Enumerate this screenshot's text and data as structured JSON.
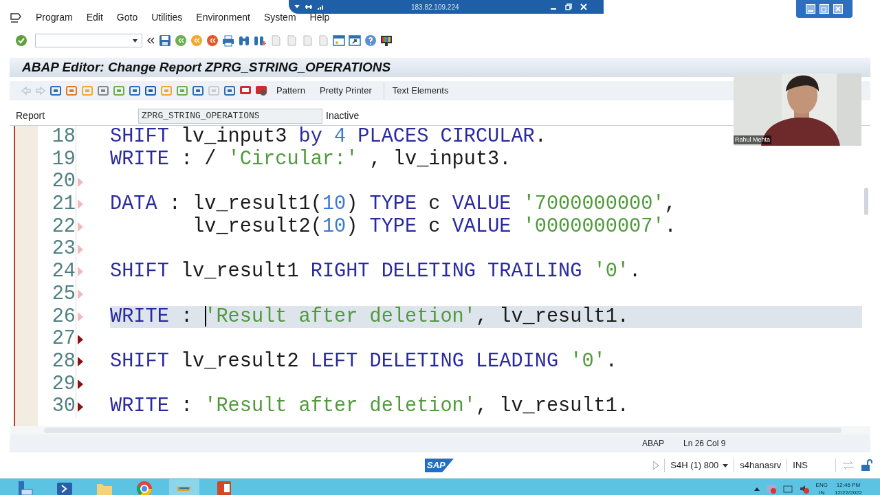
{
  "menu": [
    "Program",
    "Edit",
    "Goto",
    "Utilities",
    "Environment",
    "System",
    "Help"
  ],
  "connection": {
    "host": "183.82.109.224"
  },
  "title": "ABAP Editor: Change Report ZPRG_STRING_OPERATIONS",
  "app_toolbar": {
    "buttons": [
      "Pattern",
      "Pretty Printer",
      "Text Elements"
    ]
  },
  "report": {
    "label": "Report",
    "value": "ZPRG_STRING_OPERATIONS",
    "status": "Inactive"
  },
  "editor": {
    "lines": [
      {
        "number": "18",
        "selected": false,
        "tokens": [
          {
            "kind": "kw",
            "text": "SHIFT"
          },
          {
            "kind": "txt",
            "text": " lv_input3 "
          },
          {
            "kind": "kw",
            "text": "by "
          },
          {
            "kind": "num",
            "text": "4 "
          },
          {
            "kind": "kw",
            "text": "PLACES CIRCULAR"
          },
          {
            "kind": "txt",
            "text": "."
          }
        ]
      },
      {
        "number": "19",
        "selected": false,
        "tokens": [
          {
            "kind": "kw",
            "text": "WRITE"
          },
          {
            "kind": "txt",
            "text": " : / "
          },
          {
            "kind": "str",
            "text": "'Circular:'"
          },
          {
            "kind": "txt",
            "text": " , lv_input3."
          }
        ]
      },
      {
        "number": "20",
        "marker": {
          "color": "#f3b8b8"
        },
        "selected": false
      },
      {
        "number": "21",
        "marker": {
          "color": "#f3b8b8"
        },
        "selected": false,
        "tokens": [
          {
            "kind": "kw",
            "text": "DATA"
          },
          {
            "kind": "txt",
            "text": " : lv_result1("
          },
          {
            "kind": "num",
            "text": "10"
          },
          {
            "kind": "txt",
            "text": ") "
          },
          {
            "kind": "kw",
            "text": "TYPE"
          },
          {
            "kind": "txt",
            "text": " c "
          },
          {
            "kind": "kw",
            "text": "VALUE "
          },
          {
            "kind": "str",
            "text": "'7000000000'"
          },
          {
            "kind": "txt",
            "text": ","
          }
        ]
      },
      {
        "number": "22",
        "marker": {
          "color": "#f3b8b8"
        },
        "selected": false,
        "tokens": [
          {
            "kind": "txt",
            "text": "       lv_result2("
          },
          {
            "kind": "num",
            "text": "10"
          },
          {
            "kind": "txt",
            "text": ") "
          },
          {
            "kind": "kw",
            "text": "TYPE"
          },
          {
            "kind": "txt",
            "text": " c "
          },
          {
            "kind": "kw",
            "text": "VALUE "
          },
          {
            "kind": "str",
            "text": "'0000000007'"
          },
          {
            "kind": "txt",
            "text": "."
          }
        ]
      },
      {
        "number": "23",
        "marker": {
          "color": "#f3b8b8"
        },
        "selected": false
      },
      {
        "number": "24",
        "marker": {
          "color": "#f3b8b8"
        },
        "selected": false,
        "tokens": [
          {
            "kind": "kw",
            "text": "SHIFT"
          },
          {
            "kind": "txt",
            "text": " lv_result1 "
          },
          {
            "kind": "kw",
            "text": "RIGHT DELETING TRAILING "
          },
          {
            "kind": "str",
            "text": "'0'"
          },
          {
            "kind": "txt",
            "text": "."
          }
        ]
      },
      {
        "number": "25",
        "marker": {
          "color": "#f3b8b8"
        },
        "selected": false
      },
      {
        "number": "26",
        "marker": {
          "color": "#f3b8b8"
        },
        "selected": true,
        "tokens": [
          {
            "kind": "kw",
            "text": "WRITE"
          },
          {
            "kind": "txt",
            "text": " : "
          },
          {
            "kind": "str",
            "text": "'Result after deletion'"
          },
          {
            "kind": "txt",
            "text": ", lv_result1."
          }
        ]
      },
      {
        "number": "27",
        "marker": {
          "color": "#8b1010"
        },
        "selected": false
      },
      {
        "number": "28",
        "marker": {
          "color": "#8b1010"
        },
        "selected": false,
        "tokens": [
          {
            "kind": "kw",
            "text": "SHIFT"
          },
          {
            "kind": "txt",
            "text": " lv_result2 "
          },
          {
            "kind": "kw",
            "text": "LEFT DELETING LEADING "
          },
          {
            "kind": "str",
            "text": "'0'"
          },
          {
            "kind": "txt",
            "text": "."
          }
        ]
      },
      {
        "number": "29",
        "marker": {
          "color": "#8b1010"
        },
        "selected": false
      },
      {
        "number": "30",
        "marker": {
          "color": "#8b1010"
        },
        "selected": false,
        "tokens": [
          {
            "kind": "kw",
            "text": "WRITE"
          },
          {
            "kind": "txt",
            "text": " : "
          },
          {
            "kind": "str",
            "text": "'Result after deletion'"
          },
          {
            "kind": "txt",
            "text": ", lv_result1."
          }
        ]
      }
    ]
  },
  "webcam": {
    "kind": "picture",
    "caption": "Rahul Mehta"
  },
  "status": {
    "language": "ABAP",
    "position": "Ln 26 Col 9"
  },
  "sap_status": {
    "logo": "SAP",
    "system": "S4H (1) 800",
    "server": "s4hanasrv",
    "mode": "INS"
  },
  "taskbar": {
    "language": "ENG",
    "region": "IN",
    "time": "12:46 PM",
    "date": "12/22/2022"
  }
}
